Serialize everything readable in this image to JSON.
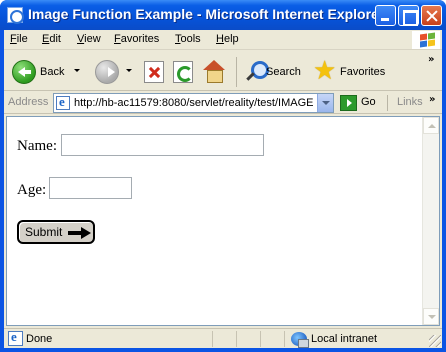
{
  "window": {
    "title": "Image Function Example - Microsoft Internet Explorer"
  },
  "menubar": {
    "items": [
      "File",
      "Edit",
      "View",
      "Favorites",
      "Tools",
      "Help"
    ]
  },
  "toolbar": {
    "back_label": "Back",
    "search_label": "Search",
    "favorites_label": "Favorites"
  },
  "addressbar": {
    "label": "Address",
    "url": "http://hb-ac11579:8080/servlet/reality/test/IMAGE",
    "go_label": "Go",
    "links_label": "Links"
  },
  "form": {
    "name_label": "Name:",
    "name_value": "",
    "age_label": "Age:",
    "age_value": "",
    "submit_label": "Submit"
  },
  "statusbar": {
    "status_text": "Done",
    "zone_text": "Local intranet"
  }
}
